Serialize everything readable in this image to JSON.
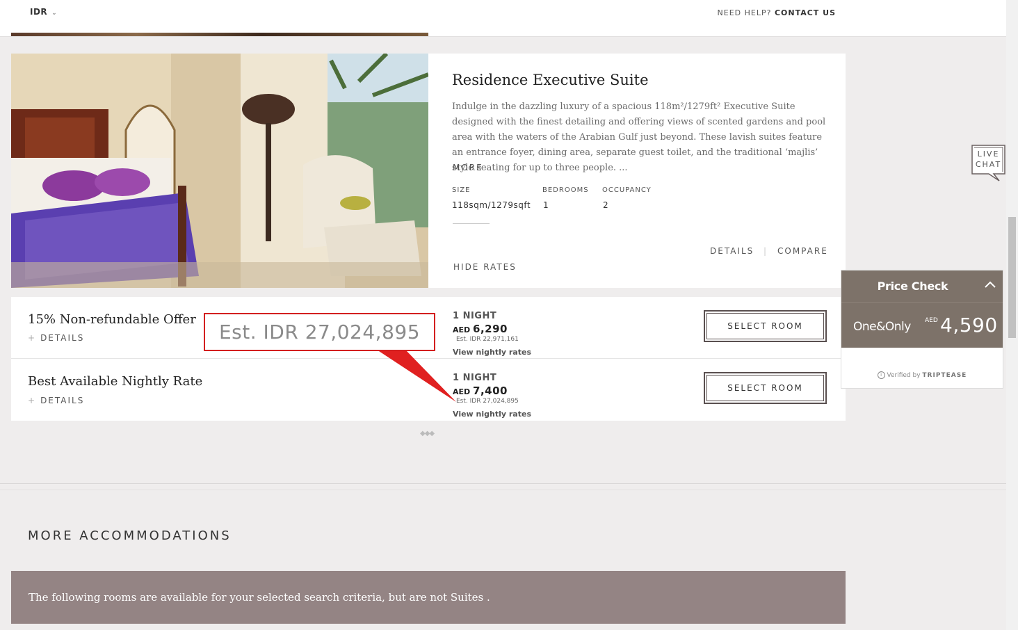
{
  "topbar": {
    "currency": "IDR",
    "help_prefix": "NEED HELP?",
    "help_link": "CONTACT US"
  },
  "room": {
    "title": "Residence Executive Suite",
    "description": "Indulge in the dazzling luxury of a spacious 118m²/1279ft² Executive Suite designed with the finest detailing and offering views of scented gardens and pool area with the waters of the Arabian Gulf just beyond. These lavish suites feature an entrance foyer, dining area, separate guest toilet, and the traditional ‘majlis’ style seating for up to three people. ...",
    "more": "MORE",
    "specs": [
      {
        "label": "SIZE",
        "value": "118sqm/1279sqft"
      },
      {
        "label": "BEDROOMS",
        "value": "1"
      },
      {
        "label": "OCCUPANCY",
        "value": "2"
      }
    ],
    "details": "DETAILS",
    "separator": "|",
    "compare": "COMPARE",
    "hide_rates": "HIDE RATES"
  },
  "rates": [
    {
      "name": "15% Non-refundable Offer",
      "details": "DETAILS",
      "plus": "+",
      "nights": "1 NIGHT",
      "currency": "AED",
      "price": "6,290",
      "est": "Est. IDR 22,971,161",
      "view": "View nightly rates",
      "button": "SELECT ROOM"
    },
    {
      "name": "Best Available Nightly Rate",
      "details": "DETAILS",
      "plus": "+",
      "nights": "1 NIGHT",
      "currency": "AED",
      "price": "7,400",
      "est": "Est. IDR 27,024,895",
      "view": "View nightly rates",
      "button": "SELECT ROOM"
    }
  ],
  "callout": {
    "text": "Est. IDR 27,024,895"
  },
  "loader": "◆◆◆",
  "more_section": {
    "title": "MORE ACCOMMODATIONS",
    "banner": "The following rooms are available for your selected search criteria, but are not Suites ."
  },
  "live_chat": {
    "line1": "LIVE",
    "line2": "CHAT"
  },
  "price_check": {
    "title": "Price Check",
    "brand": "One&Only",
    "currency": "AED",
    "price": "4,590",
    "verified_prefix": "Verified by",
    "verified_brand": "TRIPTEASE"
  },
  "colors": {
    "accent_brown": "#7d7269",
    "banner": "#948484",
    "callout_red": "#d31f1f"
  }
}
